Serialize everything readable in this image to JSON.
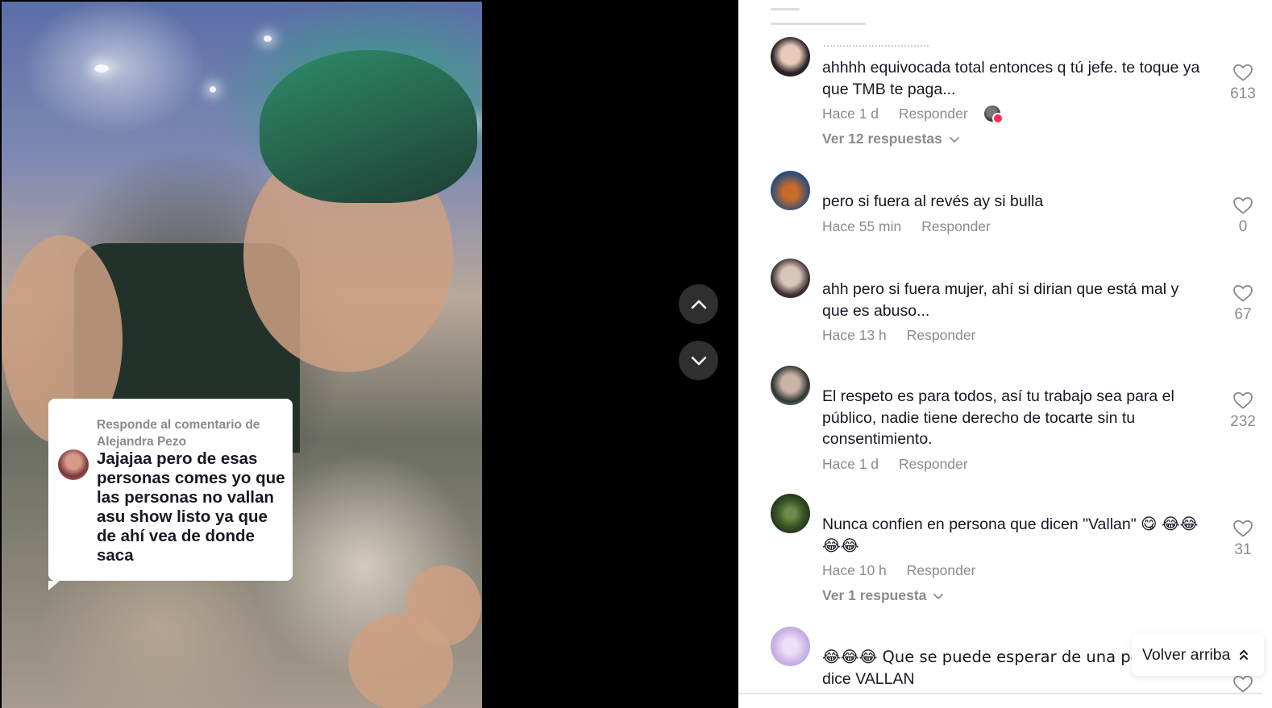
{
  "reply_card": {
    "header": "Responde al comentario de Alejandra Pezo",
    "text": "Jajajaa pero de esas personas comes yo que las personas no vallan asu show listo ya que de ahí vea de donde saca"
  },
  "navigation": {
    "prev_icon": "chevron-up-icon",
    "next_icon": "chevron-down-icon"
  },
  "comments": [
    {
      "text": "ahhhh equivocada total entonces q tú jefe. te toque ya que TMB te paga...",
      "time": "Hace 1 d",
      "reply_label": "Responder",
      "likes": "613",
      "view_replies": "Ver 12 respuestas",
      "avatar_colors": [
        "#e8c9b8",
        "#2a2226"
      ]
    },
    {
      "text": "pero si fuera al revés ay si bulla",
      "time": "Hace 55 min",
      "reply_label": "Responder",
      "likes": "0",
      "avatar_colors": [
        "#2f4f78",
        "#c76a2a"
      ]
    },
    {
      "text": "ahh pero si fuera mujer, ahí si dirian que está mal y que es abuso...",
      "time": "Hace 13 h",
      "reply_label": "Responder",
      "likes": "67",
      "avatar_colors": [
        "#d8c6bb",
        "#3a2e2e"
      ]
    },
    {
      "text": "El respeto es para todos, así tu trabajo sea para el público, nadie tiene derecho de tocarte sin tu consentimiento.",
      "time": "Hace 1 d",
      "reply_label": "Responder",
      "likes": "232",
      "avatar_colors": [
        "#b8c2bc",
        "#2d3530"
      ]
    },
    {
      "text": "Nunca confien en persona que dicen \"Vallan\" 😋 😂😂😂😂",
      "time": "Hace 10 h",
      "reply_label": "Responder",
      "likes": "31",
      "view_replies": "Ver 1 respuesta",
      "avatar_colors": [
        "#3d5a2a",
        "#1d2a16"
      ]
    },
    {
      "text": "😂😂😂 Que se puede esperar de una pe... dice VALLAN",
      "avatar_colors": [
        "#c9b3e6",
        "#ece0f7"
      ]
    }
  ],
  "comment6_line1": "😂😂😂 Que se puede esperar de una pe",
  "comment6_line2": "dice VALLAN",
  "back_to_top": {
    "label": "Volver arriba",
    "icon": "double-chevron-up-icon"
  },
  "colors": {
    "text_primary": "#161823",
    "text_secondary": "#8a8b91",
    "accent": "#fe2c55"
  }
}
